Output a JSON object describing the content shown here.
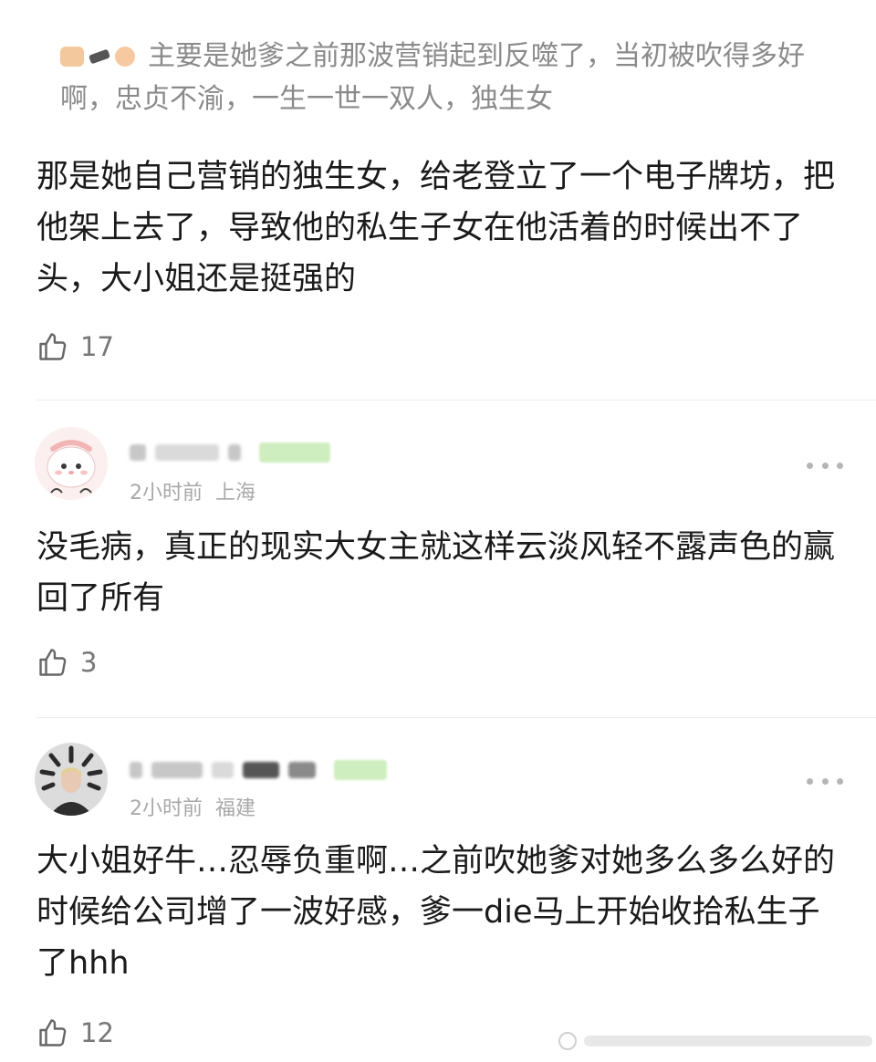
{
  "quoted_reply": {
    "emojis": [
      "clapping-hands-icon",
      "gun-icon",
      "fist-icon"
    ],
    "text": "主要是她爹之前那波营销起到反噬了，当初被吹得多好啊，忠贞不渝，一生一世一双人，独生女"
  },
  "comments": [
    {
      "text": "那是她自己营销的独生女，给老登立了一个电子牌坊，把他架上去了，导致他的私生子女在他活着的时候出不了头，大小姐还是挺强的",
      "likes": "17"
    },
    {
      "time": "2小时前",
      "location": "上海",
      "text": "没毛病，真正的现实大女主就这样云淡风轻不露声色的赢回了所有",
      "likes": "3"
    },
    {
      "time": "2小时前",
      "location": "福建",
      "text": "大小姐好牛…忍辱负重啊…之前吹她爹对她多么多么好的时候给公司增了一波好感，爹一die马上开始收拾私生子了hhh",
      "likes": "12"
    }
  ],
  "colors": {
    "text": "#1a1a1a",
    "secondary": "#8a8a8a",
    "meta": "#a8a8a8",
    "badge": "#cfeec0"
  }
}
